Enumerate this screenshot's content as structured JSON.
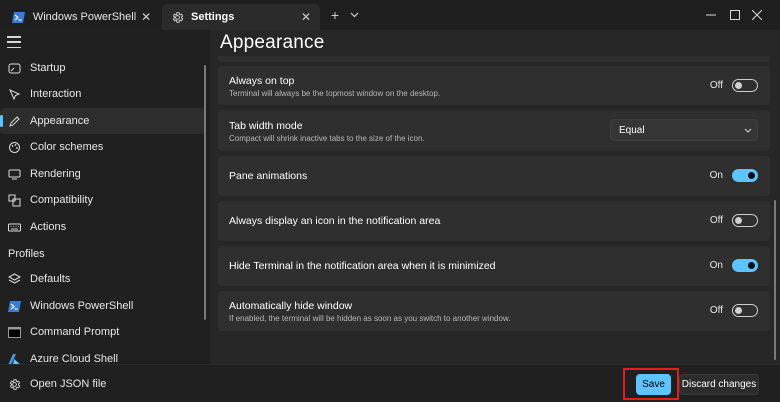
{
  "tabs": [
    {
      "label": "Windows PowerShell",
      "icon": "powershell-icon",
      "active": false
    },
    {
      "label": "Settings",
      "icon": "gear-icon",
      "active": true
    }
  ],
  "accent_color": "#5cc4ff",
  "highlight_color": "#e0201b",
  "nav": {
    "items": [
      {
        "label": "Startup",
        "icon": "startup-icon"
      },
      {
        "label": "Interaction",
        "icon": "interaction-icon"
      },
      {
        "label": "Appearance",
        "icon": "pen-icon",
        "selected": true
      },
      {
        "label": "Color schemes",
        "icon": "palette-icon"
      },
      {
        "label": "Rendering",
        "icon": "monitor-icon"
      },
      {
        "label": "Compatibility",
        "icon": "compatibility-icon"
      },
      {
        "label": "Actions",
        "icon": "keyboard-icon"
      }
    ],
    "profiles_header": "Profiles",
    "profiles": [
      {
        "label": "Defaults",
        "icon": "layers-icon"
      },
      {
        "label": "Windows PowerShell",
        "icon": "powershell-icon"
      },
      {
        "label": "Command Prompt",
        "icon": "cmd-icon"
      },
      {
        "label": "Azure Cloud Shell",
        "icon": "azure-icon"
      }
    ],
    "json_link": "Open JSON file"
  },
  "main": {
    "title": "Appearance",
    "settings": [
      {
        "title": "Always on top",
        "description": "Terminal will always be the topmost window on the desktop.",
        "control": "toggle",
        "state": "Off",
        "on": false
      },
      {
        "title": "Tab width mode",
        "description": "Compact will shrink inactive tabs to the size of the icon.",
        "control": "dropdown",
        "value": "Equal"
      },
      {
        "title": "Pane animations",
        "description": "",
        "control": "toggle",
        "state": "On",
        "on": true
      },
      {
        "title": "Always display an icon in the notification area",
        "description": "",
        "control": "toggle",
        "state": "Off",
        "on": false
      },
      {
        "title": "Hide Terminal in the notification area when it is minimized",
        "description": "",
        "control": "toggle",
        "state": "On",
        "on": true
      },
      {
        "title": "Automatically hide window",
        "description": "If enabled, the terminal will be hidden as soon as you switch to another window.",
        "control": "toggle",
        "state": "Off",
        "on": false
      }
    ]
  },
  "footer": {
    "save_label": "Save",
    "discard_label": "Discard changes"
  }
}
